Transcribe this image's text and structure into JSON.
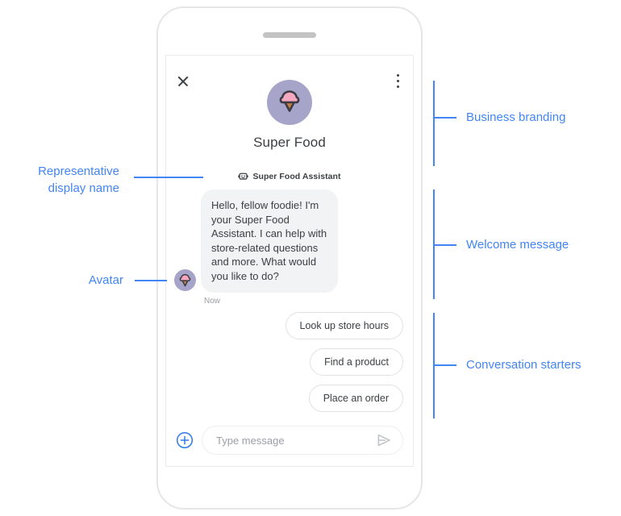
{
  "phone": {
    "speaker_name": "phone-speaker"
  },
  "chat": {
    "close_label": "Close",
    "menu_label": "More options",
    "business_name": "Super Food",
    "representative_name": "Super Food Assistant",
    "welcome_message": "Hello, fellow foodie! I'm your Super Food Assistant. I can help with store-related questions and more. What would you like to do?",
    "timestamp": "Now",
    "conversation_starters": [
      {
        "label": "Look up store hours"
      },
      {
        "label": "Find a product"
      },
      {
        "label": "Place an order"
      }
    ],
    "composer": {
      "plus_label": "Add attachment",
      "input_value": "",
      "input_placeholder": "Type message",
      "send_label": "Send"
    }
  },
  "annotations": {
    "business_branding": "Business branding",
    "welcome_message": "Welcome message",
    "conversation_starters": "Conversation starters",
    "representative_display_name_line1": "Representative",
    "representative_display_name_line2": "display name",
    "avatar": "Avatar"
  },
  "colors": {
    "accent_blue": "#4285f4",
    "logo_background": "#a6a4c8",
    "scoop_pink": "#f5a8c0",
    "cone_brown": "#c07f42",
    "outline_dark": "#3c3b44",
    "bubble_gray": "#f1f3f4",
    "text_dark": "#3c4043",
    "text_muted": "#9aa0a6"
  }
}
